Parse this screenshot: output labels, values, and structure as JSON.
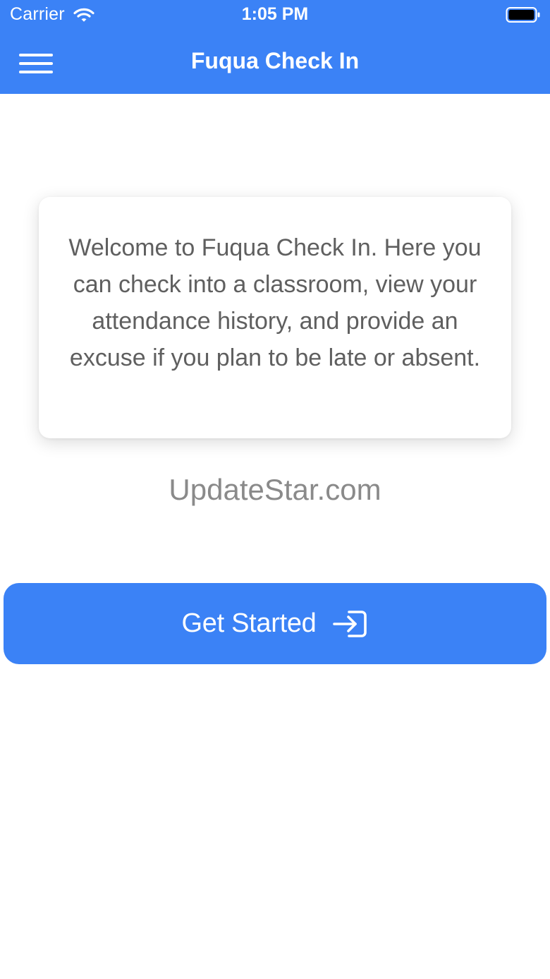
{
  "status_bar": {
    "carrier": "Carrier",
    "time": "1:05 PM",
    "icons": [
      "wifi-icon",
      "battery-icon"
    ]
  },
  "nav": {
    "title": "Fuqua Check In",
    "menu_icon": "hamburger-menu-icon"
  },
  "welcome": {
    "message": "Welcome to Fuqua Check In. Here you can check into a classroom, view your attendance history, and provide an excuse if you plan to be late or absent."
  },
  "watermark": {
    "text": "UpdateStar.com"
  },
  "actions": {
    "get_started_label": "Get Started",
    "get_started_icon": "login-arrow-icon"
  },
  "colors": {
    "accent": "#3b82f6",
    "background": "#ffffff",
    "body_text": "#5f5f5f",
    "watermark": "#8a8a8a"
  }
}
